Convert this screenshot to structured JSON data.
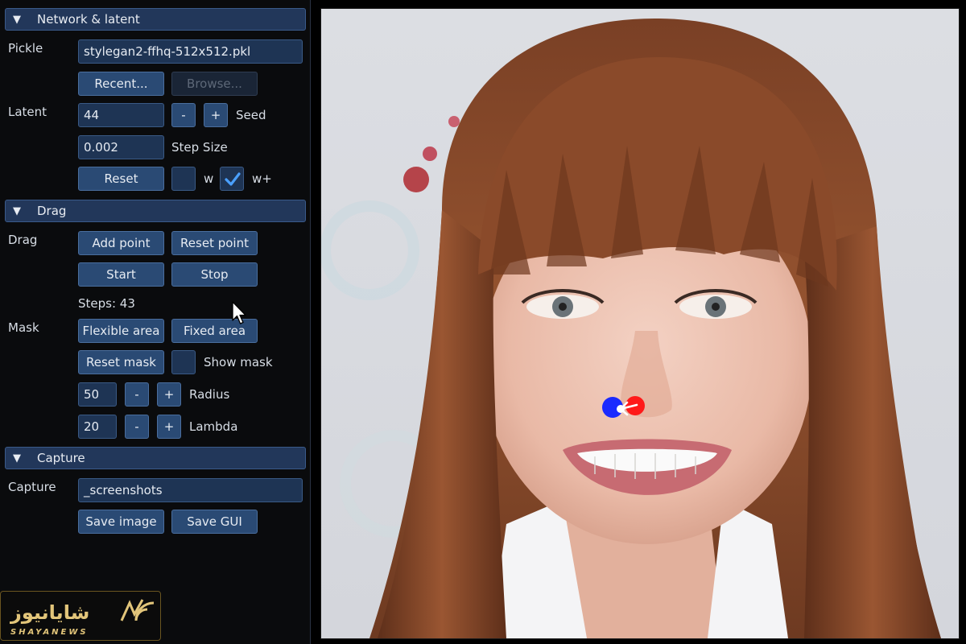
{
  "sections": {
    "network": {
      "title": "Network & latent"
    },
    "drag": {
      "title": "Drag"
    },
    "capture": {
      "title": "Capture"
    }
  },
  "network": {
    "pickle_label": "Pickle",
    "pickle_value": "stylegan2-ffhq-512x512.pkl",
    "recent_label": "Recent...",
    "browse_label": "Browse...",
    "latent_label": "Latent",
    "seed_value": "44",
    "minus": "-",
    "plus": "+",
    "seed_label": "Seed",
    "step_size_value": "0.002",
    "step_size_label": "Step Size",
    "reset_label": "Reset",
    "w_label": "w",
    "w_checked": false,
    "wplus_label": "w+",
    "wplus_checked": true
  },
  "drag": {
    "drag_label": "Drag",
    "add_point": "Add point",
    "reset_point": "Reset point",
    "start": "Start",
    "stop": "Stop",
    "steps_text": "Steps: 43",
    "mask_label": "Mask",
    "flexible_area": "Flexible area",
    "fixed_area": "Fixed area",
    "reset_mask": "Reset mask",
    "show_mask_label": "Show mask",
    "show_mask_checked": false,
    "radius_value": "50",
    "radius_label": "Radius",
    "lambda_value": "20",
    "lambda_label": "Lambda",
    "minus": "-",
    "plus": "+"
  },
  "capture": {
    "capture_label": "Capture",
    "path_value": "_screenshots",
    "save_image": "Save image",
    "save_gui": "Save GUI"
  },
  "watermark": {
    "arabic": "شایانیوز",
    "latin": "SHAYANEWS"
  },
  "colors": {
    "panel_bg": "#0a0b0d",
    "header_bg": "#22375a",
    "button_bg": "#2a4a74",
    "field_bg": "#1e3454",
    "check_color": "#4aa0ff",
    "handle_point": "#ff1a1a",
    "target_point": "#1a2aff"
  }
}
